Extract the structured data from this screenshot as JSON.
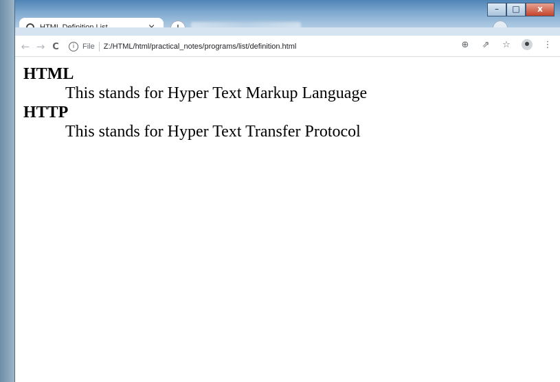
{
  "window": {
    "minimize": "–",
    "maximize": "□",
    "close": "x"
  },
  "tab": {
    "title": "HTML Definition List",
    "close": "×",
    "new_tab": "+"
  },
  "toolbar": {
    "back": "←",
    "forward": "→",
    "reload": "C",
    "scheme_label": "File",
    "url": "Z:/HTML/html/practical_notes/programs/list/definition.html",
    "zoom_icon": "⊕",
    "share_icon": "⇗",
    "bookmark_icon": "☆",
    "menu_icon": "⋮",
    "tab_dropdown": "⌄"
  },
  "page": {
    "definitions": [
      {
        "term": "HTML",
        "description": "This stands for Hyper Text Markup Language"
      },
      {
        "term": "HTTP",
        "description": "This stands for Hyper Text Transfer Protocol"
      }
    ]
  }
}
